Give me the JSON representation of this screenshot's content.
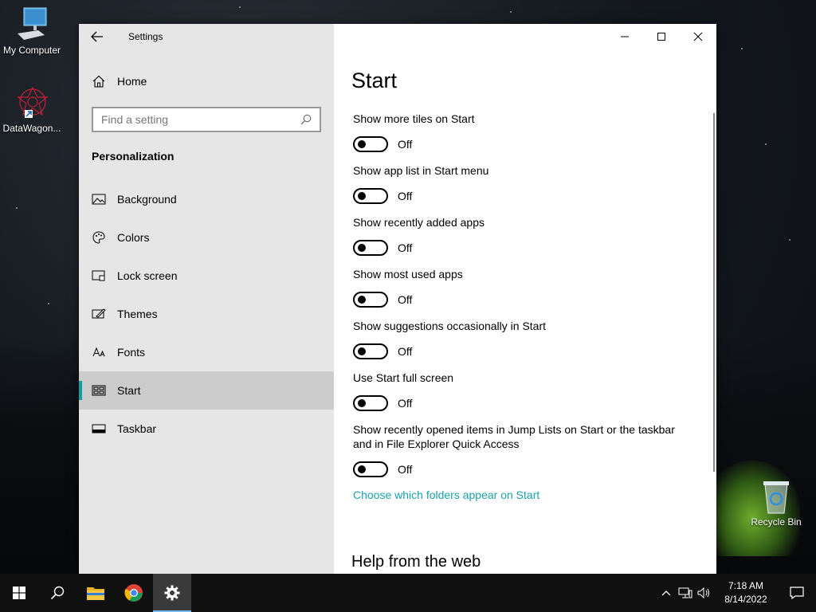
{
  "desktop": {
    "icons": [
      {
        "label": "My Computer",
        "icon": "computer-icon"
      },
      {
        "label": "DataWagon...",
        "icon": "datawagon-icon"
      },
      {
        "label": "Recycle Bin",
        "icon": "recycle-bin-icon"
      }
    ]
  },
  "window": {
    "title": "Settings",
    "back_icon": "back-arrow-icon",
    "controls": {
      "minimize": "minimize-icon",
      "maximize": "maximize-icon",
      "close": "close-icon"
    }
  },
  "sidebar": {
    "home_label": "Home",
    "search_placeholder": "Find a setting",
    "section": "Personalization",
    "items": [
      {
        "label": "Background",
        "icon": "picture-icon",
        "active": false
      },
      {
        "label": "Colors",
        "icon": "palette-icon",
        "active": false
      },
      {
        "label": "Lock screen",
        "icon": "lock-screen-icon",
        "active": false
      },
      {
        "label": "Themes",
        "icon": "brush-icon",
        "active": false
      },
      {
        "label": "Fonts",
        "icon": "fonts-icon",
        "active": false
      },
      {
        "label": "Start",
        "icon": "start-layout-icon",
        "active": true
      },
      {
        "label": "Taskbar",
        "icon": "taskbar-icon",
        "active": false
      }
    ]
  },
  "main": {
    "title": "Start",
    "settings": [
      {
        "label": "Show more tiles on Start",
        "state": "Off"
      },
      {
        "label": "Show app list in Start menu",
        "state": "Off"
      },
      {
        "label": "Show recently added apps",
        "state": "Off"
      },
      {
        "label": "Show most used apps",
        "state": "Off"
      },
      {
        "label": "Show suggestions occasionally in Start",
        "state": "Off"
      },
      {
        "label": "Use Start full screen",
        "state": "Off"
      },
      {
        "label": "Show recently opened items in Jump Lists on Start or the taskbar and in File Explorer Quick Access",
        "state": "Off"
      }
    ],
    "link": "Choose which folders appear on Start",
    "help_title": "Help from the web"
  },
  "taskbar": {
    "clock_time": "7:18 AM",
    "clock_date": "8/14/2022"
  },
  "colors": {
    "accent": "#1aa3a8",
    "sidebar_bg": "#e6e6e6",
    "taskbar_bg": "#101010"
  }
}
